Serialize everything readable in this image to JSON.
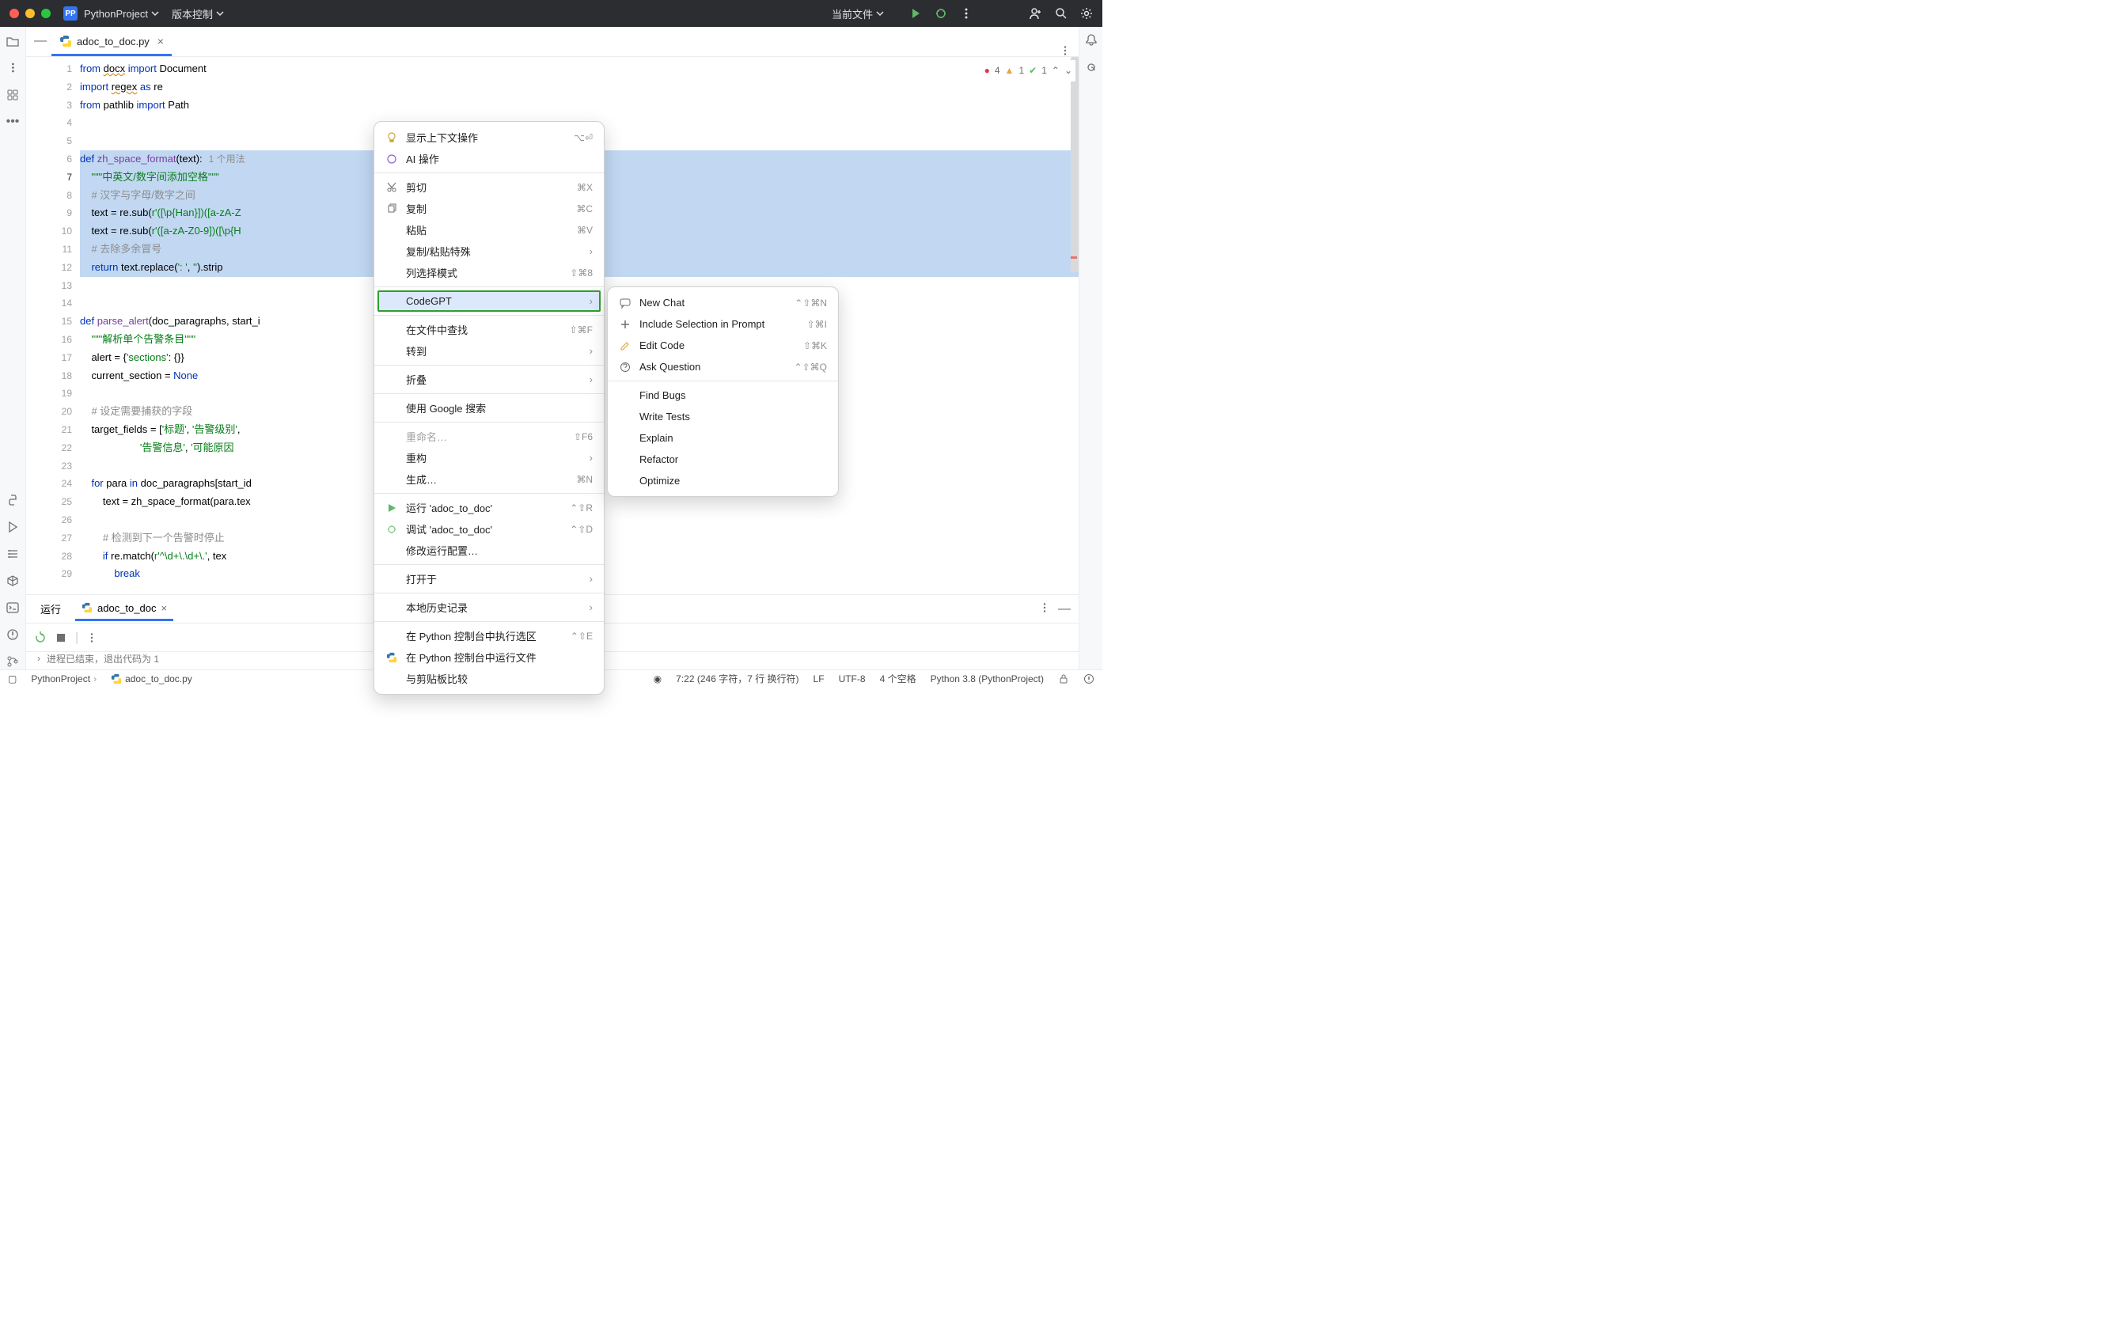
{
  "titlebar": {
    "project": "PythonProject",
    "vcs": "版本控制",
    "run_target": "当前文件"
  },
  "tabs": {
    "file_name": "adoc_to_doc.py"
  },
  "inspections": {
    "errors": "4",
    "warnings": "1",
    "weak": "1"
  },
  "code": {
    "lines": [
      "from docx import Document",
      "import regex as re",
      "from pathlib import Path",
      "",
      "",
      "def zh_space_format(text):",
      "    \"\"\"中英文/数字间添加空格\"\"\"",
      "    # 汉字与字母/数字之间",
      "    text = re.sub(r'([\\p{Han}])([a-zA-Z",
      "    text = re.sub(r'([a-zA-Z0-9])([\\p{H",
      "    # 去除多余冒号",
      "    return text.replace(': ', '').strip",
      "",
      "",
      "def parse_alert(doc_paragraphs, start_i",
      "    \"\"\"解析单个告警条目\"\"\"",
      "    alert = {'sections': {}}",
      "    current_section = None",
      "",
      "    # 设定需要捕获的字段",
      "    target_fields = ['标题', '告警级别',",
      "                     '告警信息', '可能原因",
      "",
      "    for para in doc_paragraphs[start_id",
      "        text = zh_space_format(para.tex",
      "",
      "        # 检测到下一个告警时停止",
      "        if re.match(r'^\\d+\\.\\d+\\.', tex",
      "            break"
    ],
    "usage": "1 个用法"
  },
  "context_menu": {
    "items": [
      {
        "label": "显示上下文操作",
        "shortcut": "⌥⏎",
        "icon": "bulb"
      },
      {
        "label": "AI 操作",
        "icon": "ai"
      },
      {
        "sep": true
      },
      {
        "label": "剪切",
        "shortcut": "⌘X",
        "icon": "cut"
      },
      {
        "label": "复制",
        "shortcut": "⌘C",
        "icon": "copy"
      },
      {
        "label": "粘贴",
        "shortcut": "⌘V"
      },
      {
        "label": "复制/粘贴特殊",
        "submenu": true
      },
      {
        "label": "列选择模式",
        "shortcut": "⇧⌘8"
      },
      {
        "sep": true
      },
      {
        "label": "CodeGPT",
        "submenu": true,
        "highlight": true
      },
      {
        "sep": true
      },
      {
        "label": "在文件中查找",
        "shortcut": "⇧⌘F"
      },
      {
        "label": "转到",
        "submenu": true
      },
      {
        "sep": true
      },
      {
        "label": "折叠",
        "submenu": true
      },
      {
        "sep": true
      },
      {
        "label": "使用 Google 搜索"
      },
      {
        "sep": true
      },
      {
        "label": "重命名…",
        "shortcut": "⇧F6",
        "disabled": true
      },
      {
        "label": "重构",
        "submenu": true
      },
      {
        "label": "生成…",
        "shortcut": "⌘N"
      },
      {
        "sep": true
      },
      {
        "label": "运行 'adoc_to_doc'",
        "shortcut": "⌃⇧R",
        "icon": "run"
      },
      {
        "label": "调试 'adoc_to_doc'",
        "shortcut": "⌃⇧D",
        "icon": "debug"
      },
      {
        "label": "修改运行配置…"
      },
      {
        "sep": true
      },
      {
        "label": "打开于",
        "submenu": true
      },
      {
        "sep": true
      },
      {
        "label": "本地历史记录",
        "submenu": true
      },
      {
        "sep": true
      },
      {
        "label": "在 Python 控制台中执行选区",
        "shortcut": "⌃⇧E"
      },
      {
        "label": "在 Python 控制台中运行文件",
        "icon": "python"
      },
      {
        "label": "与剪贴板比较"
      }
    ]
  },
  "sub_menu": {
    "items": [
      {
        "label": "New Chat",
        "shortcut": "⌃⇧⌘N",
        "icon": "chat"
      },
      {
        "label": "Include Selection in Prompt",
        "shortcut": "⇧⌘I",
        "icon": "plus"
      },
      {
        "label": "Edit Code",
        "shortcut": "⇧⌘K",
        "icon": "edit"
      },
      {
        "label": "Ask Question",
        "shortcut": "⌃⇧⌘Q",
        "icon": "question"
      },
      {
        "sep": true
      },
      {
        "label": "Find Bugs"
      },
      {
        "label": "Write Tests"
      },
      {
        "label": "Explain"
      },
      {
        "label": "Refactor"
      },
      {
        "label": "Optimize"
      }
    ]
  },
  "run_panel": {
    "title": "运行",
    "tab": "adoc_to_doc",
    "output": "进程已结束，退出代码为 1"
  },
  "statusbar": {
    "project": "PythonProject",
    "file": "adoc_to_doc.py",
    "position": "7:22 (246 字符，7 行 换行符)",
    "line_sep": "LF",
    "encoding": "UTF-8",
    "indent": "4 个空格",
    "interpreter": "Python 3.8 (PythonProject)"
  }
}
